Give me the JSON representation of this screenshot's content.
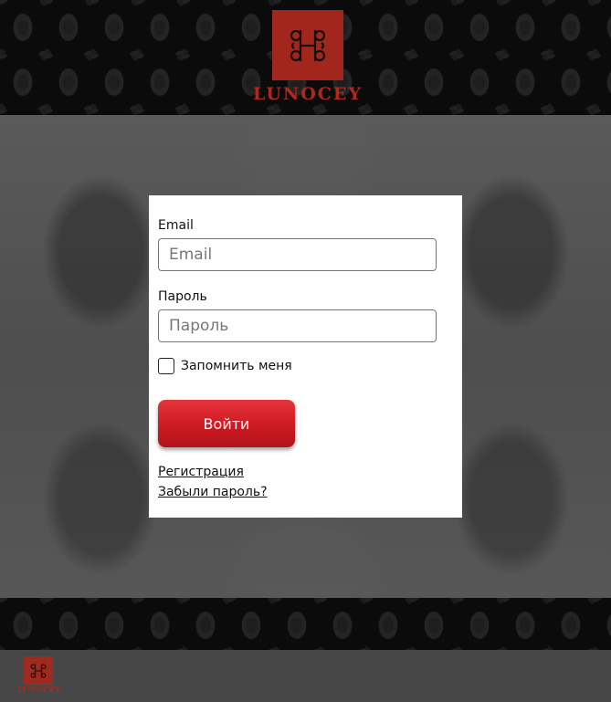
{
  "brand": {
    "name": "LUNOCEY",
    "accent": "#a3261c"
  },
  "form": {
    "email_label": "Email",
    "email_placeholder": "Email",
    "password_label": "Пароль",
    "password_placeholder": "Пароль",
    "remember_label": "Запомнить меня",
    "remember_checked": false,
    "submit_label": "Войти",
    "submit_color": "#cd1a22",
    "register_link": "Регистрация",
    "forgot_link": "Забыли пароль?"
  },
  "icons": {
    "logo": "logo-icon"
  }
}
